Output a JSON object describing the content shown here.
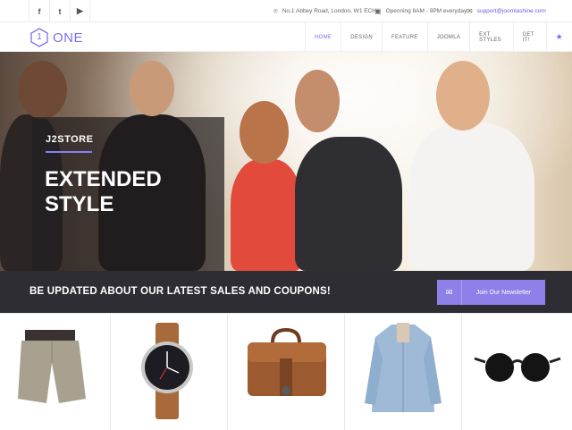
{
  "topbar": {
    "social": [
      {
        "icon": "facebook-icon",
        "glyph": "f"
      },
      {
        "icon": "twitter-icon",
        "glyph": "t"
      },
      {
        "icon": "youtube-icon",
        "glyph": "▶"
      }
    ],
    "address": "No.1 Abbey Road, London, W1 ECH",
    "hours": "Openning 8AM - 9PM everyday",
    "email": "support@joomlashine.com"
  },
  "header": {
    "logo_number": "1",
    "logo_text": "ONE",
    "menu": [
      {
        "label": "HOME",
        "active": true
      },
      {
        "label": "DESIGN",
        "active": false
      },
      {
        "label": "FEATURE",
        "active": false
      },
      {
        "label": "JOOMLA",
        "active": false
      },
      {
        "label": "EXT STYLES",
        "active": false
      },
      {
        "label": "GET IT!",
        "active": false
      }
    ],
    "star_glyph": "★"
  },
  "hero": {
    "brand": "J2STORE",
    "headline_line1": "EXTENDED",
    "headline_line2": "STYLE"
  },
  "newsletter": {
    "message": "BE UPDATED ABOUT OUR LATEST SALES AND COUPONS!",
    "button_label": "Join Our Newsletter"
  },
  "products": [
    {
      "name": "shorts",
      "icon": "shorts-image"
    },
    {
      "name": "watch",
      "icon": "watch-image"
    },
    {
      "name": "bag",
      "icon": "briefcase-image"
    },
    {
      "name": "shirt",
      "icon": "denim-shirt-image"
    },
    {
      "name": "sunglasses",
      "icon": "sunglasses-image"
    }
  ],
  "colors": {
    "accent": "#7a6ff0",
    "button": "#8d80e8",
    "band": "#2f2d34"
  }
}
